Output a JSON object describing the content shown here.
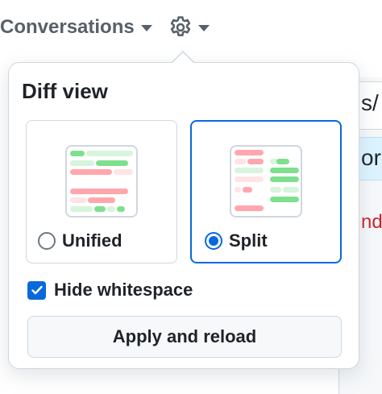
{
  "toolbar": {
    "conversations_label": "Conversations",
    "icons": {
      "conversations_caret": "chevron-down-icon",
      "settings": "gear-icon",
      "settings_caret": "chevron-down-icon"
    }
  },
  "background": {
    "row1_text": "s/",
    "row2_text": "or",
    "row3_text": "nd"
  },
  "popover": {
    "title": "Diff view",
    "options": [
      {
        "label": "Unified",
        "selected": false,
        "icon": "unified-diff-icon"
      },
      {
        "label": "Split",
        "selected": true,
        "icon": "split-diff-icon"
      }
    ],
    "hide_whitespace": {
      "label": "Hide whitespace",
      "checked": true
    },
    "apply_label": "Apply and reload"
  },
  "colors": {
    "accent": "#0969da",
    "addition": "#7ee08f",
    "deletion": "#ffa7ad",
    "border": "#d0d7de",
    "muted_text": "#57606a"
  }
}
